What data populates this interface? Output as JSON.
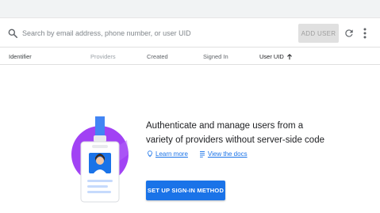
{
  "search": {
    "placeholder": "Search by email address, phone number, or user UID",
    "add_user_label": "ADD USER"
  },
  "icons": {
    "search": "search-icon",
    "refresh": "refresh-icon",
    "more": "more-vert-icon",
    "sort": "arrow-up-icon",
    "learn_more": "lightbulb-icon",
    "docs": "document-icon"
  },
  "table": {
    "columns": [
      {
        "label": "Identifier"
      },
      {
        "label": "Providers"
      },
      {
        "label": "Created"
      },
      {
        "label": "Signed In"
      },
      {
        "label": "User UID"
      }
    ]
  },
  "empty_state": {
    "line1": "Authenticate and manage users from a",
    "line2": "variety of providers without server-side code",
    "learn_more": "Learn more",
    "view_docs": "View the docs",
    "cta": "SET UP SIGN-IN METHOD"
  },
  "colors": {
    "accent": "#1a73e8",
    "illustration_bg": "#a142f4",
    "disabled_button": "#e0e0e0"
  }
}
